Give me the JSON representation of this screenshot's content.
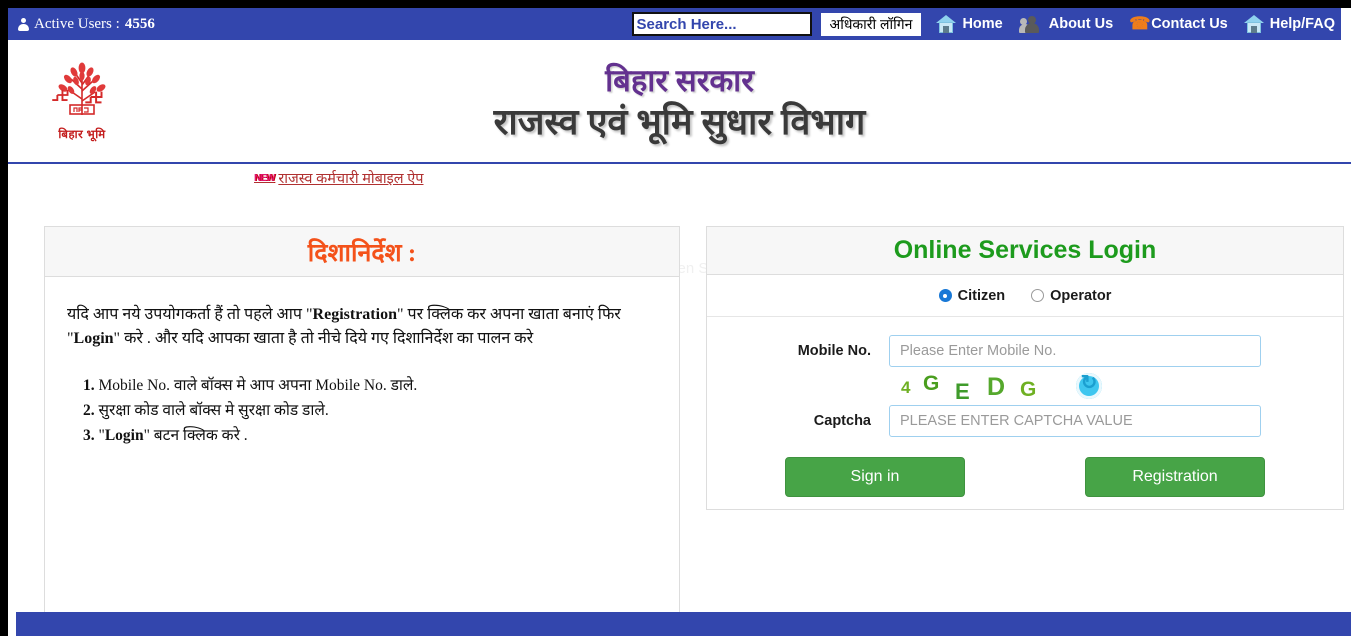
{
  "topbar": {
    "active_users_label": "Active Users :",
    "active_users_count": "4556",
    "user_icon": "user-icon",
    "search": {
      "placeholder": "Search Here...",
      "value": "",
      "icon": "search-input"
    },
    "officer_login_label": "अधिकारी लॉगिन",
    "nav_items": [
      {
        "label": "Home",
        "icon": "home-icon"
      },
      {
        "label": "About Us",
        "icon": "people-icon"
      },
      {
        "label": "Contact Us",
        "icon": "phone-icon"
      },
      {
        "label": "Help/FAQ",
        "icon": "home-icon"
      }
    ],
    "bg_color": "#3346ad"
  },
  "masthead": {
    "logo_caption": "बिहार भूमि",
    "logo_icon": "bihar-bhumi-emblem",
    "title_line1": "बिहार सरकार",
    "title_line2": "राजस्व एवं भूमि सुधार विभाग",
    "title1_color": "#63318f",
    "title2_color": "#3a3a3a"
  },
  "strip": {
    "new_badge": "NEW",
    "app_link_label": "राजस्व कर्मचारी मोबाइल ऐप"
  },
  "guidelines": {
    "title": "दिशानिर्देश :",
    "title_color": "#f4521a",
    "intro_part1": "यदि आप नये उपयोगकर्ता हैं तो पहले आप \"",
    "intro_bold1": "Registration",
    "intro_part2": "\" पर क्लिक कर अपना खाता बनाएं फिर \"",
    "intro_bold2": "Login",
    "intro_part3": "\" करे . और यदि आपका खाता है तो नीचे दिये गए दिशानिर्देश का पालन करे",
    "items": [
      {
        "num": "1.",
        "text": "Mobile No. वाले बॉक्स मे आप अपना Mobile No. डाले."
      },
      {
        "num": "2.",
        "text": "सुरक्षा कोड वाले बॉक्स मे सुरक्षा कोड डाले."
      },
      {
        "num": "3.",
        "pre": "\"",
        "bold": "Login",
        "post": "\" बटन क्लिक करे ."
      }
    ]
  },
  "login": {
    "title": "Online Services Login",
    "title_color": "#1d9b1d",
    "user_types": [
      {
        "label": "Citizen",
        "selected": true
      },
      {
        "label": "Operator",
        "selected": false
      }
    ],
    "mobile_label": "Mobile No.",
    "mobile_placeholder": "Please Enter Mobile No.",
    "mobile_value": "",
    "captcha_label": "Captcha",
    "captcha_placeholder": "PLEASE ENTER CAPTCHA VALUE",
    "captcha_value": "",
    "captcha_code": "4GEDG",
    "captcha_chars": [
      "4",
      "G",
      "E",
      "D",
      "G"
    ],
    "refresh_icon": "refresh-captcha-icon",
    "signin_label": "Sign in",
    "registration_label": "Registration",
    "button_color": "#47a447"
  },
  "watermark": {
    "text": "Full-screen Snip",
    "text2": "Snip"
  }
}
